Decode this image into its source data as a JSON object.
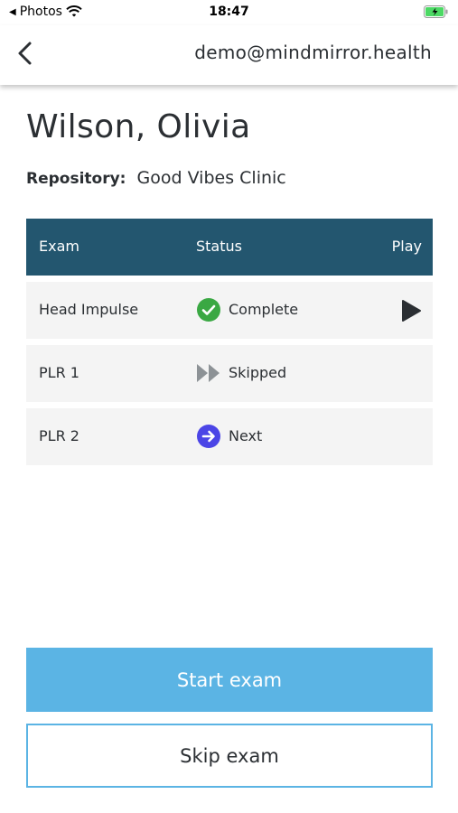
{
  "status_bar": {
    "back_app": "Photos",
    "time": "18:47"
  },
  "nav": {
    "back_icon": "chevron-left-icon",
    "email": "demo@mindmirror.health"
  },
  "patient": {
    "name": "Wilson, Olivia",
    "repository_label": "Repository:",
    "repository_value": "Good Vibes Clinic"
  },
  "table": {
    "headers": {
      "exam": "Exam",
      "status": "Status",
      "play": "Play"
    },
    "rows": [
      {
        "exam": "Head Impulse",
        "status": "Complete",
        "status_icon": "check-circle-icon",
        "has_play": true
      },
      {
        "exam": "PLR 1",
        "status": "Skipped",
        "status_icon": "fast-forward-icon",
        "has_play": false
      },
      {
        "exam": "PLR 2",
        "status": "Next",
        "status_icon": "arrow-right-circle-icon",
        "has_play": false
      }
    ]
  },
  "actions": {
    "start": "Start exam",
    "skip": "Skip exam"
  },
  "colors": {
    "header_bg": "#23566f",
    "primary_button": "#5bb4e4",
    "complete_green": "#3aa843",
    "next_purple": "#4b45e6",
    "skipped_gray": "#8d9296"
  }
}
